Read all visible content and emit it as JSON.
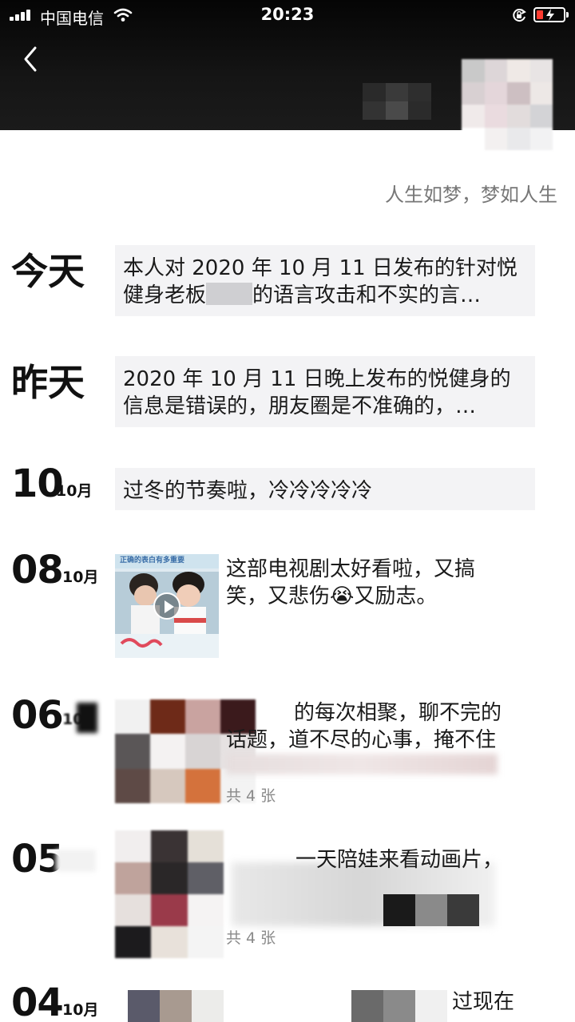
{
  "status_bar": {
    "carrier": "中国电信",
    "time": "20:23"
  },
  "profile": {
    "signature": "人生如梦，梦如人生"
  },
  "posts": [
    {
      "date_label": "今天",
      "lines": [
        "本人对 2020 年 10 月 11 日发布的针对悦",
        "的语言攻击和不实的言…"
      ],
      "line2_prefix": "健身老板"
    },
    {
      "date_label": "昨天",
      "lines": [
        "2020 年 10 月 11 日晚上发布的悦健身的",
        "信息是错误的，朋友圈是不准确的，…"
      ]
    },
    {
      "day": "10",
      "month": "10月",
      "lines": [
        "过冬的节奏啦，冷冷冷冷冷"
      ]
    },
    {
      "day": "08",
      "month": "10月",
      "lines": [
        "这部电视剧太好看啦，又搞",
        "笑，又悲伤😭又励志。"
      ],
      "thumb_caption": "正确的表白有多重要"
    },
    {
      "day": "06",
      "month": "10",
      "lines": [
        "的每次相聚，聊不完的",
        "话题，道不尽的心事，掩不住"
      ],
      "photo_count": "共 4 张"
    },
    {
      "day": "05",
      "lines": [
        "一天陪娃来看动画片，"
      ],
      "photo_count": "共 4 张"
    },
    {
      "day": "04",
      "month": "10月",
      "lines": [
        "过现在"
      ]
    }
  ],
  "colors": {
    "cover_bg": "#0b0b0b",
    "text_box_bg": "#f3f3f5",
    "battery_low": "#ff3b30"
  },
  "icons": [
    "cellular-signal-icon",
    "wifi-icon",
    "rotation-lock-icon",
    "battery-charging-icon",
    "back-chevron-icon",
    "play-icon"
  ]
}
